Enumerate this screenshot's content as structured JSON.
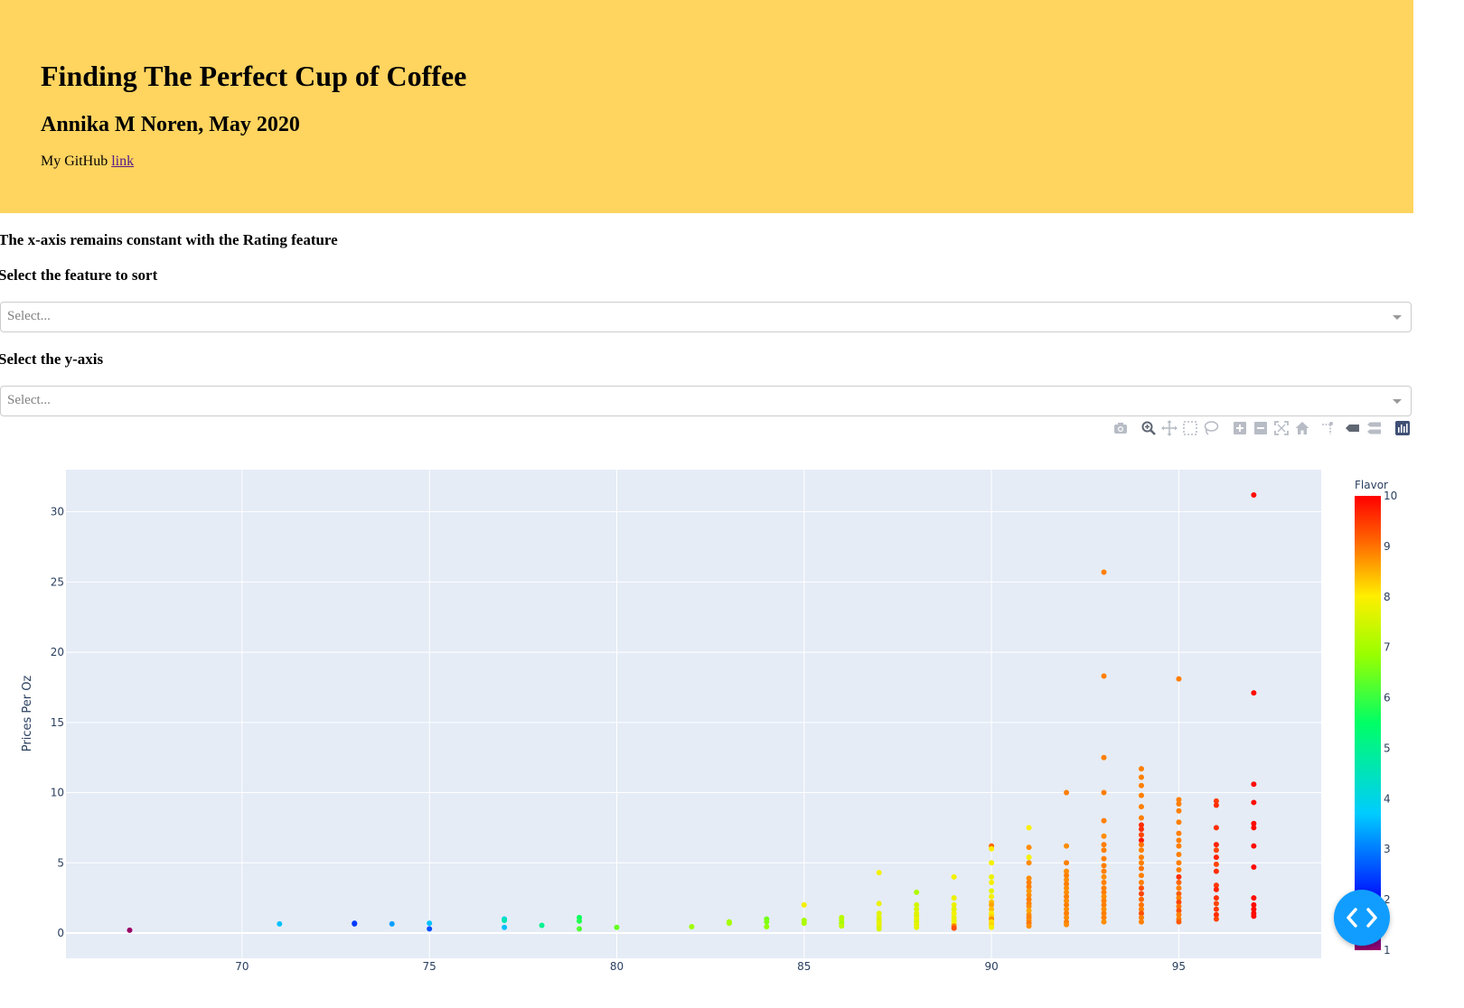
{
  "header": {
    "title": "Finding The Perfect Cup of Coffee",
    "author": "Annika M Noren, May 2020",
    "github_prefix": "My GitHub ",
    "github_link_text": "link",
    "background_color": "#ffd45f"
  },
  "controls": {
    "note": "The x-axis remains constant with the Rating feature",
    "sort_label": "Select the feature to sort",
    "sort_placeholder": "Select...",
    "yaxis_label": "Select the y-axis",
    "yaxis_placeholder": "Select..."
  },
  "modebar": {
    "icons": [
      "camera-icon",
      "zoom-icon",
      "pan-icon",
      "box-select-icon",
      "lasso-select-icon",
      "zoom-in-icon",
      "zoom-out-icon",
      "autoscale-icon",
      "reset-axes-icon",
      "spike-lines-icon",
      "hover-closest-icon",
      "hover-compare-icon",
      "plotly-logo-icon"
    ]
  },
  "chart_data": {
    "type": "scatter",
    "xlabel": "",
    "ylabel": "Prices Per Oz",
    "xlim": [
      65.3,
      98.8
    ],
    "ylim": [
      -1.8,
      33
    ],
    "xticks": [
      70,
      75,
      80,
      85,
      90,
      95
    ],
    "yticks": [
      0,
      5,
      10,
      15,
      20,
      25,
      30
    ],
    "grid": true,
    "plot_background": "#e5ecf6",
    "colorbar": {
      "title": "Flavor",
      "range": [
        1,
        10
      ],
      "ticks": [
        1,
        2,
        3,
        4,
        5,
        6,
        7,
        8,
        9,
        10
      ],
      "colorscale": [
        [
          0,
          "#990066"
        ],
        [
          0.1,
          "#0000ff"
        ],
        [
          0.3,
          "#00ccff"
        ],
        [
          0.5,
          "#00ff66"
        ],
        [
          0.65,
          "#99ff00"
        ],
        [
          0.78,
          "#ffee00"
        ],
        [
          0.9,
          "#ff6600"
        ],
        [
          1,
          "#ff0000"
        ]
      ]
    },
    "points": [
      [
        67,
        0.2,
        1
      ],
      [
        71,
        0.65,
        3.6
      ],
      [
        73,
        0.7,
        2.5
      ],
      [
        73,
        0.65,
        2.4
      ],
      [
        74,
        0.65,
        3.3
      ],
      [
        75,
        0.7,
        3.6
      ],
      [
        75,
        0.3,
        2.6
      ],
      [
        77,
        1.0,
        4.0
      ],
      [
        77,
        0.9,
        4.6
      ],
      [
        77,
        0.4,
        3.6
      ],
      [
        78,
        0.55,
        5.0
      ],
      [
        79,
        1.1,
        5.6
      ],
      [
        79,
        0.85,
        5.8
      ],
      [
        79,
        0.3,
        6.2
      ],
      [
        80,
        0.4,
        6.4
      ],
      [
        82,
        0.45,
        6.9
      ],
      [
        83,
        0.8,
        6.9
      ],
      [
        83,
        0.7,
        7.0
      ],
      [
        84,
        1.0,
        6.5
      ],
      [
        84,
        0.8,
        6.6
      ],
      [
        84,
        0.45,
        6.8
      ],
      [
        85,
        2.0,
        7.9
      ],
      [
        85,
        0.9,
        7.0
      ],
      [
        85,
        0.7,
        7.1
      ],
      [
        86,
        1.1,
        7.2
      ],
      [
        86,
        0.9,
        7.2
      ],
      [
        86,
        0.7,
        7.0
      ],
      [
        86,
        0.5,
        7.3
      ],
      [
        87,
        4.3,
        7.9
      ],
      [
        87,
        2.1,
        7.8
      ],
      [
        87,
        1.4,
        7.7
      ],
      [
        87,
        1.1,
        7.7
      ],
      [
        87,
        0.9,
        7.6
      ],
      [
        87,
        0.7,
        7.8
      ],
      [
        87,
        0.5,
        7.7
      ],
      [
        87,
        0.3,
        7.6
      ],
      [
        88,
        2.9,
        7.1
      ],
      [
        88,
        2.0,
        7.5
      ],
      [
        88,
        1.7,
        7.6
      ],
      [
        88,
        1.4,
        7.7
      ],
      [
        88,
        1.2,
        7.6
      ],
      [
        88,
        1.0,
        7.8
      ],
      [
        88,
        0.8,
        7.6
      ],
      [
        88,
        0.6,
        7.7
      ],
      [
        88,
        0.4,
        7.7
      ],
      [
        89,
        4.0,
        7.9
      ],
      [
        89,
        2.5,
        7.8
      ],
      [
        89,
        2.0,
        7.8
      ],
      [
        89,
        1.7,
        7.7
      ],
      [
        89,
        1.4,
        7.9
      ],
      [
        89,
        1.1,
        7.8
      ],
      [
        89,
        0.9,
        7.8
      ],
      [
        89,
        0.7,
        7.9
      ],
      [
        89,
        0.5,
        8.9
      ],
      [
        89,
        0.35,
        9.3
      ],
      [
        90,
        6.2,
        9.1
      ],
      [
        90,
        6.0,
        8.0
      ],
      [
        90,
        5.0,
        7.9
      ],
      [
        90,
        4.0,
        7.8
      ],
      [
        90,
        3.6,
        7.9
      ],
      [
        90,
        3.0,
        7.7
      ],
      [
        90,
        2.6,
        7.9
      ],
      [
        90,
        2.2,
        8.4
      ],
      [
        90,
        2.0,
        8.6
      ],
      [
        90,
        1.7,
        8.4
      ],
      [
        90,
        1.4,
        8.0
      ],
      [
        90,
        1.2,
        8.2
      ],
      [
        90,
        1.0,
        8.8
      ],
      [
        90,
        0.8,
        8.1
      ],
      [
        90,
        0.6,
        8.2
      ],
      [
        90,
        0.4,
        7.9
      ],
      [
        91,
        7.5,
        8.0
      ],
      [
        91,
        6.1,
        8.8
      ],
      [
        91,
        5.4,
        7.9
      ],
      [
        91,
        5.0,
        8.8
      ],
      [
        91,
        3.9,
        8.8
      ],
      [
        91,
        3.6,
        8.9
      ],
      [
        91,
        3.3,
        8.9
      ],
      [
        91,
        3.0,
        8.7
      ],
      [
        91,
        2.7,
        8.8
      ],
      [
        91,
        2.4,
        8.9
      ],
      [
        91,
        2.1,
        8.9
      ],
      [
        91,
        1.9,
        8.8
      ],
      [
        91,
        1.6,
        8.6
      ],
      [
        91,
        1.3,
        8.8
      ],
      [
        91,
        1.1,
        8.9
      ],
      [
        91,
        0.9,
        8.8
      ],
      [
        91,
        0.7,
        9.0
      ],
      [
        91,
        0.5,
        8.8
      ],
      [
        92,
        10.0,
        8.9
      ],
      [
        92,
        6.2,
        8.8
      ],
      [
        92,
        5.0,
        8.9
      ],
      [
        92,
        4.4,
        8.8
      ],
      [
        92,
        4.1,
        8.9
      ],
      [
        92,
        3.8,
        8.8
      ],
      [
        92,
        3.5,
        8.9
      ],
      [
        92,
        3.2,
        8.8
      ],
      [
        92,
        2.9,
        8.8
      ],
      [
        92,
        2.6,
        8.9
      ],
      [
        92,
        2.3,
        8.8
      ],
      [
        92,
        2.0,
        8.9
      ],
      [
        92,
        1.7,
        8.8
      ],
      [
        92,
        1.4,
        8.9
      ],
      [
        92,
        1.1,
        8.8
      ],
      [
        92,
        0.8,
        8.9
      ],
      [
        92,
        0.6,
        8.8
      ],
      [
        93,
        25.7,
        8.9
      ],
      [
        93,
        18.3,
        8.9
      ],
      [
        93,
        12.5,
        8.9
      ],
      [
        93,
        10.0,
        8.9
      ],
      [
        93,
        8.0,
        8.9
      ],
      [
        93,
        6.9,
        8.8
      ],
      [
        93,
        6.3,
        8.9
      ],
      [
        93,
        5.9,
        8.9
      ],
      [
        93,
        5.3,
        8.9
      ],
      [
        93,
        4.8,
        8.9
      ],
      [
        93,
        4.4,
        8.9
      ],
      [
        93,
        4.0,
        8.8
      ],
      [
        93,
        3.6,
        8.9
      ],
      [
        93,
        3.2,
        8.9
      ],
      [
        93,
        2.9,
        8.9
      ],
      [
        93,
        2.6,
        8.8
      ],
      [
        93,
        2.3,
        8.9
      ],
      [
        93,
        2.0,
        8.9
      ],
      [
        93,
        1.7,
        8.8
      ],
      [
        93,
        1.4,
        8.9
      ],
      [
        93,
        1.1,
        8.9
      ],
      [
        93,
        0.8,
        8.8
      ],
      [
        94,
        11.7,
        8.9
      ],
      [
        94,
        11.1,
        8.9
      ],
      [
        94,
        10.5,
        8.9
      ],
      [
        94,
        9.8,
        8.9
      ],
      [
        94,
        9.0,
        8.9
      ],
      [
        94,
        8.2,
        8.9
      ],
      [
        94,
        7.7,
        9.6
      ],
      [
        94,
        7.4,
        9.6
      ],
      [
        94,
        7.0,
        9.4
      ],
      [
        94,
        6.6,
        9.8
      ],
      [
        94,
        6.3,
        9.0
      ],
      [
        94,
        5.9,
        8.9
      ],
      [
        94,
        5.4,
        8.9
      ],
      [
        94,
        5.0,
        8.9
      ],
      [
        94,
        4.6,
        9.0
      ],
      [
        94,
        4.1,
        8.9
      ],
      [
        94,
        3.6,
        8.9
      ],
      [
        94,
        3.2,
        9.3
      ],
      [
        94,
        2.8,
        9.4
      ],
      [
        94,
        2.4,
        9.1
      ],
      [
        94,
        2.0,
        9.0
      ],
      [
        94,
        1.7,
        8.9
      ],
      [
        94,
        1.4,
        9.3
      ],
      [
        94,
        1.1,
        8.9
      ],
      [
        94,
        0.8,
        8.9
      ],
      [
        95,
        18.1,
        8.9
      ],
      [
        95,
        9.5,
        8.9
      ],
      [
        95,
        9.2,
        8.9
      ],
      [
        95,
        8.7,
        8.9
      ],
      [
        95,
        7.9,
        8.9
      ],
      [
        95,
        7.1,
        8.9
      ],
      [
        95,
        6.6,
        8.9
      ],
      [
        95,
        6.2,
        8.9
      ],
      [
        95,
        5.6,
        8.9
      ],
      [
        95,
        5.0,
        8.9
      ],
      [
        95,
        4.5,
        8.9
      ],
      [
        95,
        4.0,
        9.6
      ],
      [
        95,
        3.6,
        9.1
      ],
      [
        95,
        3.2,
        8.9
      ],
      [
        95,
        2.8,
        9.2
      ],
      [
        95,
        2.5,
        8.9
      ],
      [
        95,
        2.2,
        9.4
      ],
      [
        95,
        1.9,
        9.0
      ],
      [
        95,
        1.6,
        9.3
      ],
      [
        95,
        1.3,
        8.9
      ],
      [
        95,
        1.0,
        8.9
      ],
      [
        95,
        0.8,
        9.2
      ],
      [
        96,
        9.4,
        9.5
      ],
      [
        96,
        9.1,
        9.6
      ],
      [
        96,
        7.5,
        9.6
      ],
      [
        96,
        6.3,
        9.7
      ],
      [
        96,
        5.9,
        9.4
      ],
      [
        96,
        5.4,
        9.7
      ],
      [
        96,
        4.9,
        9.4
      ],
      [
        96,
        4.4,
        9.6
      ],
      [
        96,
        3.4,
        9.5
      ],
      [
        96,
        3.1,
        9.7
      ],
      [
        96,
        2.5,
        9.6
      ],
      [
        96,
        2.1,
        9.4
      ],
      [
        96,
        1.7,
        9.5
      ],
      [
        96,
        1.3,
        9.6
      ],
      [
        96,
        1.0,
        9.4
      ],
      [
        97,
        31.2,
        9.9
      ],
      [
        97,
        17.1,
        9.9
      ],
      [
        97,
        10.6,
        9.9
      ],
      [
        97,
        9.3,
        9.9
      ],
      [
        97,
        7.8,
        9.9
      ],
      [
        97,
        7.5,
        9.9
      ],
      [
        97,
        6.2,
        9.9
      ],
      [
        97,
        4.7,
        9.9
      ],
      [
        97,
        2.5,
        9.9
      ],
      [
        97,
        2.0,
        9.9
      ],
      [
        97,
        1.7,
        9.9
      ],
      [
        97,
        1.4,
        9.9
      ],
      [
        97,
        1.2,
        9.9
      ]
    ]
  }
}
